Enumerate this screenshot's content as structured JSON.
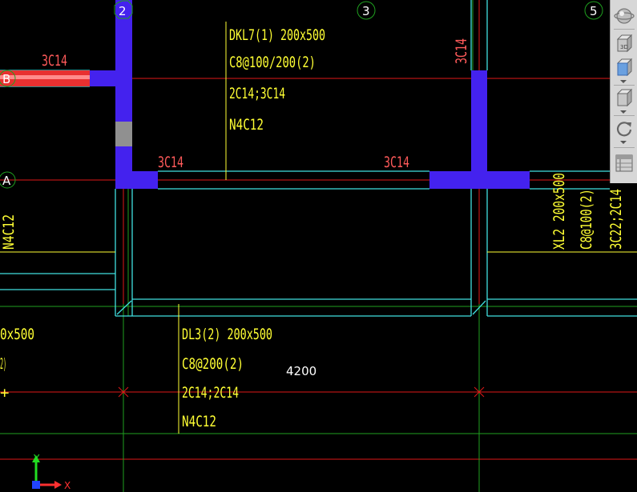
{
  "grid": {
    "axis_2": "2",
    "axis_3": "3",
    "axis_5": "5",
    "axis_B": "B",
    "axis_A": "A"
  },
  "annotations": {
    "dkl7_name": "DKL7(1) 200x500",
    "dkl7_stirrup": "C8@100/200(2)",
    "dkl7_main": "2C14;3C14",
    "dkl7_side": "N4C12",
    "dl3_name": "DL3(2) 200x500",
    "dl3_stirrup": "C8@200(2)",
    "dl3_main": "2C14;2C14",
    "dl3_side": "N4C12",
    "xl2_name": "XL2 200x500",
    "xl2_stirrup": "C8@100(2)",
    "xl2_main": "3C22;2C14",
    "left_side_vertical": "N4C12",
    "left_partial_name": "0x500",
    "left_partial_stirrup": "2)",
    "left_partial_mark": "+",
    "rebar_b_left": "3C14",
    "rebar_a_left": "3C14",
    "rebar_a_right": "3C14",
    "rebar_col3_vertical": "3C14",
    "dimension": "4200"
  },
  "ucs": {
    "x_label": "X",
    "y_label": "Y"
  },
  "viewcube": {
    "btn_3d_label": "3D"
  },
  "colors": {
    "background": "#000000",
    "grid_red": "#ff2020",
    "grid_green": "#1fa01f",
    "beam_cyan": "#40e0e0",
    "column_blue": "#4422ee",
    "annotation_yellow": "#ffff33",
    "rebar_pink": "#ff5a5a",
    "grid_bubble": "#1fa01f"
  }
}
